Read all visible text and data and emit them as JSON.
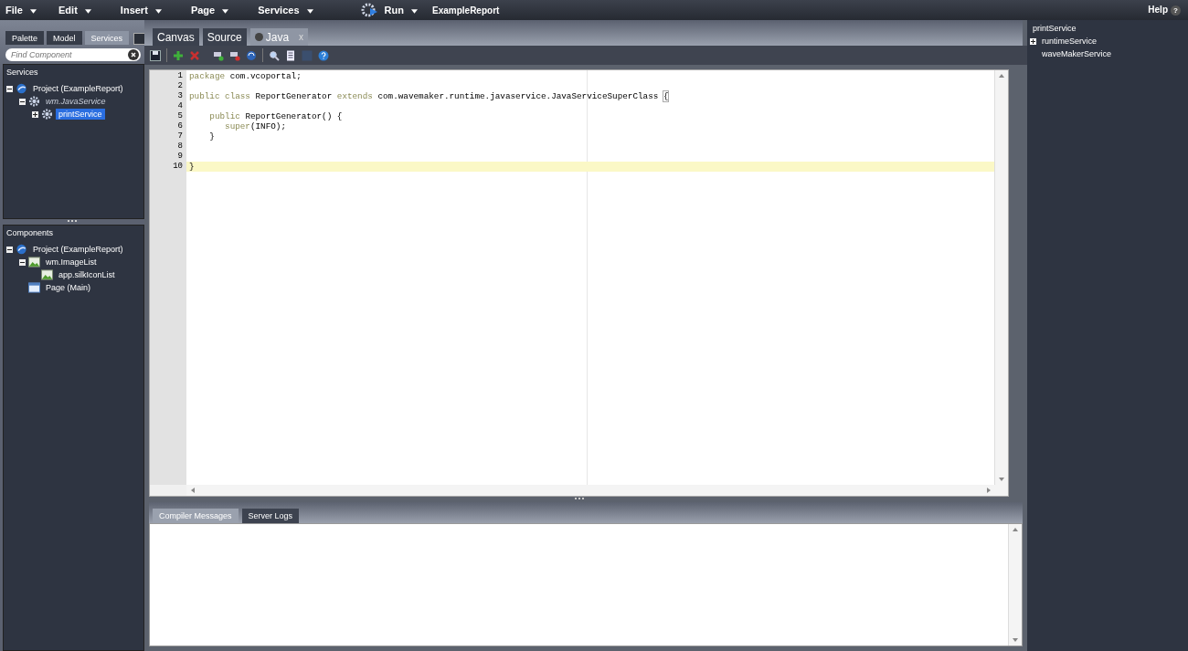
{
  "menu": [
    {
      "label": "File"
    },
    {
      "label": "Edit"
    },
    {
      "label": "Insert"
    },
    {
      "label": "Page"
    },
    {
      "label": "Services"
    }
  ],
  "run": {
    "label": "Run"
  },
  "project_title": "ExampleReport",
  "help": {
    "label": "Help",
    "icon": "?"
  },
  "palette_tabs": [
    {
      "label": "Palette",
      "selected": false
    },
    {
      "label": "Model",
      "selected": false
    },
    {
      "label": "Services",
      "selected": true
    }
  ],
  "search": {
    "placeholder": "Find Component"
  },
  "services_panel": {
    "title": "Services",
    "tree": [
      {
        "label": "Project (ExampleReport)",
        "kind": "project",
        "expanded": true,
        "italic": false,
        "selected": false,
        "children": [
          {
            "label": "wm.JavaService",
            "kind": "gear",
            "expanded": true,
            "italic": true,
            "selected": false,
            "children": [
              {
                "label": "printService",
                "kind": "gear",
                "expanded": false,
                "italic": false,
                "selected": true
              }
            ]
          }
        ]
      }
    ]
  },
  "components_panel": {
    "title": "Components",
    "tree": [
      {
        "label": "Project (ExampleReport)",
        "kind": "project",
        "expanded": true,
        "italic": false,
        "selected": false,
        "children": [
          {
            "label": "wm.ImageList",
            "kind": "image",
            "expanded": true,
            "italic": false,
            "selected": false,
            "children": [
              {
                "label": "app.silkIconList",
                "kind": "image",
                "italic": false,
                "selected": false
              }
            ]
          },
          {
            "label": "Page (Main)",
            "kind": "page",
            "italic": false,
            "selected": false
          }
        ]
      }
    ]
  },
  "editor_tabs": [
    {
      "label": "Canvas",
      "selected": false,
      "closable": false
    },
    {
      "label": "Source",
      "selected": false,
      "closable": false
    },
    {
      "label": "Java",
      "selected": true,
      "closable": true,
      "close": "x"
    }
  ],
  "code_lines": [
    {
      "number": "1",
      "current": false,
      "segments": [
        {
          "text": "package",
          "kind": "keyword"
        },
        {
          "text": " com.vcoportal;",
          "kind": "plain"
        }
      ]
    },
    {
      "number": "2",
      "current": false
    },
    {
      "number": "3",
      "current": false,
      "segments": [
        {
          "text": "public class",
          "kind": "keyword"
        },
        {
          "text": " ReportGenerator ",
          "kind": "plain"
        },
        {
          "text": "extends",
          "kind": "keyword"
        },
        {
          "text": " com.wavemaker.runtime.javaservice.JavaServiceSuperClass ",
          "kind": "plain"
        },
        {
          "text": "{",
          "kind": "bracket"
        }
      ]
    },
    {
      "number": "4",
      "current": false
    },
    {
      "number": "5",
      "current": false,
      "segments": [
        {
          "text": "    public",
          "kind": "keyword"
        },
        {
          "text": " ReportGenerator() {",
          "kind": "plain"
        }
      ]
    },
    {
      "number": "6",
      "current": false,
      "segments": [
        {
          "text": "       super",
          "kind": "keyword"
        },
        {
          "text": "(INFO);",
          "kind": "plain"
        }
      ]
    },
    {
      "number": "7",
      "current": false,
      "segments": [
        {
          "text": "    }",
          "kind": "plain"
        }
      ]
    },
    {
      "number": "8",
      "current": false
    },
    {
      "number": "9",
      "current": false
    },
    {
      "number": "10",
      "current": true,
      "segments": [
        {
          "text": "}",
          "kind": "plain"
        }
      ]
    }
  ],
  "bottom_tabs": [
    {
      "label": "Compiler Messages",
      "selected": true
    },
    {
      "label": "Server Logs",
      "selected": false
    }
  ],
  "outline": [
    {
      "label": "printService",
      "expandable": false
    },
    {
      "label": "runtimeService",
      "expandable": true
    },
    {
      "label": "waveMakerService",
      "expandable": false
    }
  ]
}
